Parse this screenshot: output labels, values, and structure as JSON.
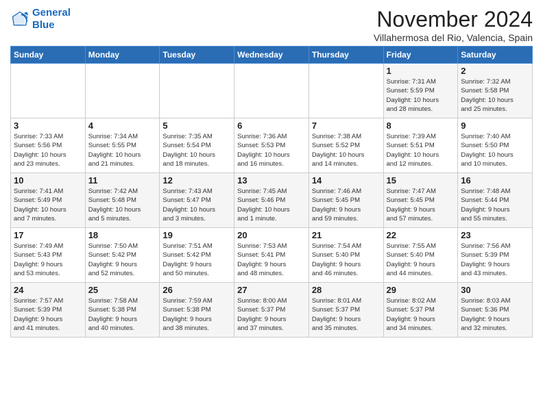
{
  "header": {
    "logo_line1": "General",
    "logo_line2": "Blue",
    "month": "November 2024",
    "location": "Villahermosa del Rio, Valencia, Spain"
  },
  "weekdays": [
    "Sunday",
    "Monday",
    "Tuesday",
    "Wednesday",
    "Thursday",
    "Friday",
    "Saturday"
  ],
  "weeks": [
    [
      {
        "day": "",
        "info": ""
      },
      {
        "day": "",
        "info": ""
      },
      {
        "day": "",
        "info": ""
      },
      {
        "day": "",
        "info": ""
      },
      {
        "day": "",
        "info": ""
      },
      {
        "day": "1",
        "info": "Sunrise: 7:31 AM\nSunset: 5:59 PM\nDaylight: 10 hours\nand 28 minutes."
      },
      {
        "day": "2",
        "info": "Sunrise: 7:32 AM\nSunset: 5:58 PM\nDaylight: 10 hours\nand 25 minutes."
      }
    ],
    [
      {
        "day": "3",
        "info": "Sunrise: 7:33 AM\nSunset: 5:56 PM\nDaylight: 10 hours\nand 23 minutes."
      },
      {
        "day": "4",
        "info": "Sunrise: 7:34 AM\nSunset: 5:55 PM\nDaylight: 10 hours\nand 21 minutes."
      },
      {
        "day": "5",
        "info": "Sunrise: 7:35 AM\nSunset: 5:54 PM\nDaylight: 10 hours\nand 18 minutes."
      },
      {
        "day": "6",
        "info": "Sunrise: 7:36 AM\nSunset: 5:53 PM\nDaylight: 10 hours\nand 16 minutes."
      },
      {
        "day": "7",
        "info": "Sunrise: 7:38 AM\nSunset: 5:52 PM\nDaylight: 10 hours\nand 14 minutes."
      },
      {
        "day": "8",
        "info": "Sunrise: 7:39 AM\nSunset: 5:51 PM\nDaylight: 10 hours\nand 12 minutes."
      },
      {
        "day": "9",
        "info": "Sunrise: 7:40 AM\nSunset: 5:50 PM\nDaylight: 10 hours\nand 10 minutes."
      }
    ],
    [
      {
        "day": "10",
        "info": "Sunrise: 7:41 AM\nSunset: 5:49 PM\nDaylight: 10 hours\nand 7 minutes."
      },
      {
        "day": "11",
        "info": "Sunrise: 7:42 AM\nSunset: 5:48 PM\nDaylight: 10 hours\nand 5 minutes."
      },
      {
        "day": "12",
        "info": "Sunrise: 7:43 AM\nSunset: 5:47 PM\nDaylight: 10 hours\nand 3 minutes."
      },
      {
        "day": "13",
        "info": "Sunrise: 7:45 AM\nSunset: 5:46 PM\nDaylight: 10 hours\nand 1 minute."
      },
      {
        "day": "14",
        "info": "Sunrise: 7:46 AM\nSunset: 5:45 PM\nDaylight: 9 hours\nand 59 minutes."
      },
      {
        "day": "15",
        "info": "Sunrise: 7:47 AM\nSunset: 5:45 PM\nDaylight: 9 hours\nand 57 minutes."
      },
      {
        "day": "16",
        "info": "Sunrise: 7:48 AM\nSunset: 5:44 PM\nDaylight: 9 hours\nand 55 minutes."
      }
    ],
    [
      {
        "day": "17",
        "info": "Sunrise: 7:49 AM\nSunset: 5:43 PM\nDaylight: 9 hours\nand 53 minutes."
      },
      {
        "day": "18",
        "info": "Sunrise: 7:50 AM\nSunset: 5:42 PM\nDaylight: 9 hours\nand 52 minutes."
      },
      {
        "day": "19",
        "info": "Sunrise: 7:51 AM\nSunset: 5:42 PM\nDaylight: 9 hours\nand 50 minutes."
      },
      {
        "day": "20",
        "info": "Sunrise: 7:53 AM\nSunset: 5:41 PM\nDaylight: 9 hours\nand 48 minutes."
      },
      {
        "day": "21",
        "info": "Sunrise: 7:54 AM\nSunset: 5:40 PM\nDaylight: 9 hours\nand 46 minutes."
      },
      {
        "day": "22",
        "info": "Sunrise: 7:55 AM\nSunset: 5:40 PM\nDaylight: 9 hours\nand 44 minutes."
      },
      {
        "day": "23",
        "info": "Sunrise: 7:56 AM\nSunset: 5:39 PM\nDaylight: 9 hours\nand 43 minutes."
      }
    ],
    [
      {
        "day": "24",
        "info": "Sunrise: 7:57 AM\nSunset: 5:39 PM\nDaylight: 9 hours\nand 41 minutes."
      },
      {
        "day": "25",
        "info": "Sunrise: 7:58 AM\nSunset: 5:38 PM\nDaylight: 9 hours\nand 40 minutes."
      },
      {
        "day": "26",
        "info": "Sunrise: 7:59 AM\nSunset: 5:38 PM\nDaylight: 9 hours\nand 38 minutes."
      },
      {
        "day": "27",
        "info": "Sunrise: 8:00 AM\nSunset: 5:37 PM\nDaylight: 9 hours\nand 37 minutes."
      },
      {
        "day": "28",
        "info": "Sunrise: 8:01 AM\nSunset: 5:37 PM\nDaylight: 9 hours\nand 35 minutes."
      },
      {
        "day": "29",
        "info": "Sunrise: 8:02 AM\nSunset: 5:37 PM\nDaylight: 9 hours\nand 34 minutes."
      },
      {
        "day": "30",
        "info": "Sunrise: 8:03 AM\nSunset: 5:36 PM\nDaylight: 9 hours\nand 32 minutes."
      }
    ]
  ]
}
